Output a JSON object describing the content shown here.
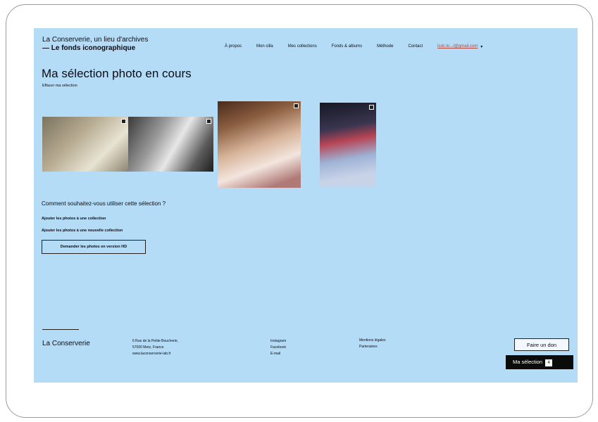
{
  "brand": {
    "line1": "La Conserverie, un lieu d'archives",
    "line2": "— Le fonds iconographique"
  },
  "nav": {
    "items": [
      "À propos",
      "Mon cilla",
      "Mes collections",
      "Fonds & albums",
      "Méthode",
      "Contact"
    ],
    "email": "lcdc.lo.../@gmail.com"
  },
  "page": {
    "title": "Ma sélection photo en cours",
    "clear_link": "Effacer ma sélection"
  },
  "actions": {
    "question": "Comment souhaitez-vous utiliser cette sélection ?",
    "add_existing": "Ajouter les photos à une collection",
    "add_new": "Ajouter les photos à une nouvelle collection",
    "hd_button": "Demander les photos en version HD"
  },
  "footer": {
    "brand": "La Conserverie",
    "address": [
      "6 Rue de la Petite Boucherie,",
      "57000 Metz, France",
      "www.laconserverie-lab.fr"
    ],
    "social": [
      "Instagram",
      "Facebook",
      "E-mail"
    ],
    "legal": [
      "Mentions légales",
      "Partenaires"
    ],
    "donate_button": "Faire un don",
    "selection_button": "Ma sélection",
    "selection_count": "4"
  }
}
